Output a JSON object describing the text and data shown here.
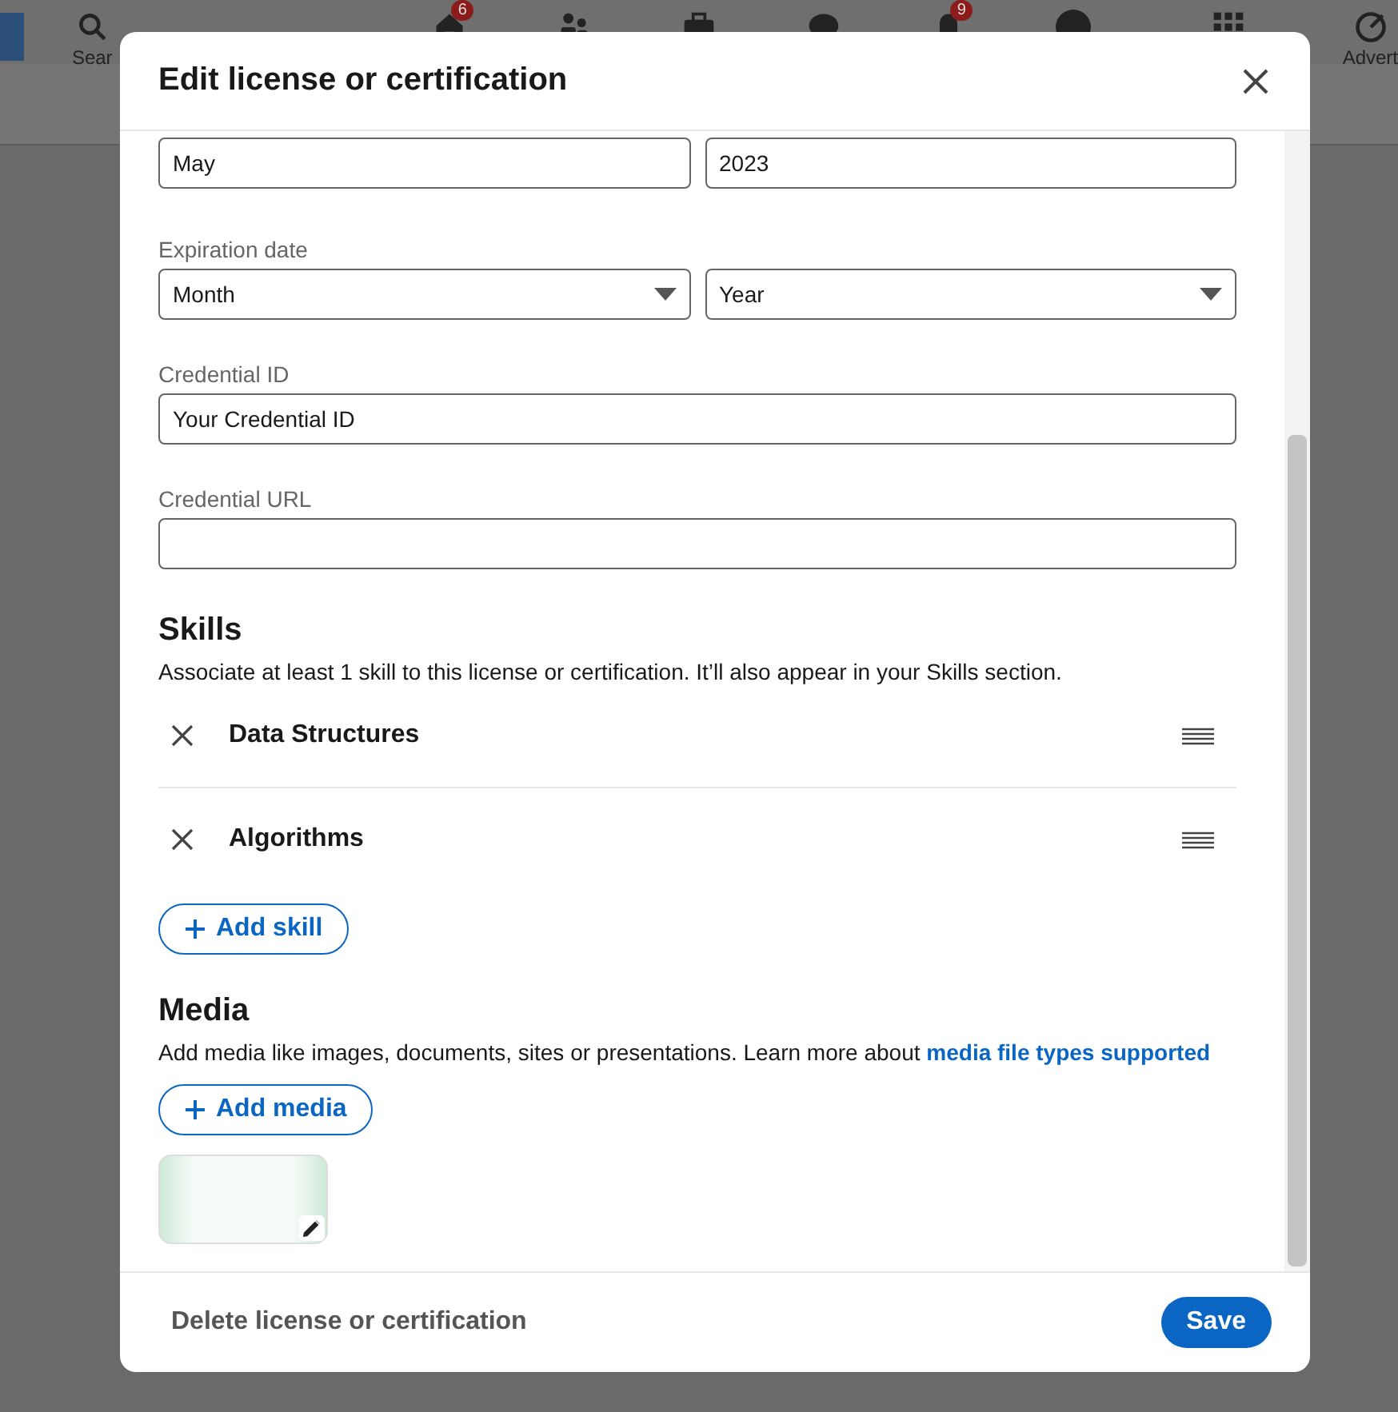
{
  "nav": {
    "items": [
      {
        "kind": "search",
        "label": "Sear"
      },
      {
        "kind": "home",
        "badge": "6"
      },
      {
        "kind": "people"
      },
      {
        "kind": "briefcase"
      },
      {
        "kind": "chat"
      },
      {
        "kind": "bell",
        "badge": "9"
      },
      {
        "kind": "avatar"
      },
      {
        "kind": "grid"
      },
      {
        "kind": "advertise",
        "label": "Advert"
      }
    ]
  },
  "dialog": {
    "title": "Edit license or certification",
    "issue": {
      "month": "May",
      "year": "2023"
    },
    "expiration": {
      "label": "Expiration date",
      "month_placeholder": "Month",
      "year_placeholder": "Year"
    },
    "credential_id": {
      "label": "Credential ID",
      "value": "Your Credential ID"
    },
    "credential_url": {
      "label": "Credential URL"
    },
    "skills": {
      "heading": "Skills",
      "description": "Associate at least 1 skill to this license or certification. It’ll also appear in your Skills section.",
      "items": [
        {
          "name": "Data Structures"
        },
        {
          "name": "Algorithms"
        }
      ],
      "add_button": "Add skill"
    },
    "media": {
      "heading": "Media",
      "description": "Add media like images, documents, sites or presentations. Learn more about",
      "link": "media file types supported",
      "add_button": "Add media"
    },
    "delete_button": "Delete license or certification",
    "save_button": "Save"
  }
}
